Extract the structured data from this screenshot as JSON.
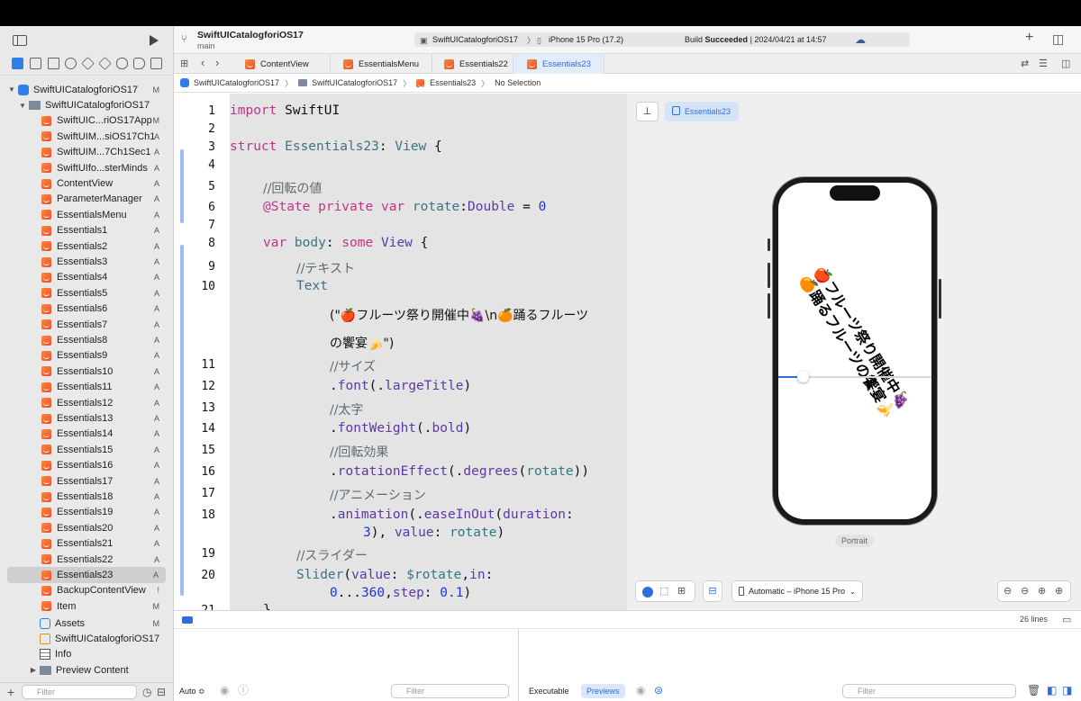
{
  "toolbar": {
    "project_title": "SwiftUICatalogforiOS17",
    "branch": "main",
    "scheme": "SwiftUICatalogforiOS17",
    "device": "iPhone 15 Pro (17.2)",
    "build_prefix": "Build",
    "build_status": "Succeeded",
    "build_time": "| 2024/04/21 at 14:57"
  },
  "tabs": [
    {
      "label": "ContentView"
    },
    {
      "label": "EssentialsMenu"
    },
    {
      "label": "Essentials22"
    },
    {
      "label": "Essentials23"
    }
  ],
  "breadcrumb": [
    "SwiftUICatalogforiOS17",
    "SwiftUICatalogforiOS17",
    "Essentials23",
    "No Selection"
  ],
  "navigator": {
    "root": {
      "label": "SwiftUICatalogforiOS17",
      "status": "M"
    },
    "group": {
      "label": "SwiftUICatalogforiOS17"
    },
    "files": [
      {
        "label": "SwiftUIC...riOS17App",
        "status": "M"
      },
      {
        "label": "SwiftUIM...siOS17Ch1",
        "status": "A"
      },
      {
        "label": "SwiftUIM...7Ch1Sec1",
        "status": "A"
      },
      {
        "label": "SwiftUIfo...sterMinds",
        "status": "A"
      },
      {
        "label": "ContentView",
        "status": "A"
      },
      {
        "label": "ParameterManager",
        "status": "A"
      },
      {
        "label": "EssentialsMenu",
        "status": "A"
      },
      {
        "label": "Essentials1",
        "status": "A"
      },
      {
        "label": "Essentials2",
        "status": "A"
      },
      {
        "label": "Essentials3",
        "status": "A"
      },
      {
        "label": "Essentials4",
        "status": "A"
      },
      {
        "label": "Essentials5",
        "status": "A"
      },
      {
        "label": "Essentials6",
        "status": "A"
      },
      {
        "label": "Essentials7",
        "status": "A"
      },
      {
        "label": "Essentials8",
        "status": "A"
      },
      {
        "label": "Essentials9",
        "status": "A"
      },
      {
        "label": "Essentials10",
        "status": "A"
      },
      {
        "label": "Essentials11",
        "status": "A"
      },
      {
        "label": "Essentials12",
        "status": "A"
      },
      {
        "label": "Essentials13",
        "status": "A"
      },
      {
        "label": "Essentials14",
        "status": "A"
      },
      {
        "label": "Essentials15",
        "status": "A"
      },
      {
        "label": "Essentials16",
        "status": "A"
      },
      {
        "label": "Essentials17",
        "status": "A"
      },
      {
        "label": "Essentials18",
        "status": "A"
      },
      {
        "label": "Essentials19",
        "status": "A"
      },
      {
        "label": "Essentials20",
        "status": "A"
      },
      {
        "label": "Essentials21",
        "status": "A"
      },
      {
        "label": "Essentials22",
        "status": "A"
      },
      {
        "label": "Essentials23",
        "status": "A"
      },
      {
        "label": "BackupContentView",
        "status": "!"
      },
      {
        "label": "Item",
        "status": "M"
      }
    ],
    "assets": {
      "label": "Assets",
      "status": "M"
    },
    "plan": {
      "label": "SwiftUICatalogforiOS17"
    },
    "info": {
      "label": "Info"
    },
    "preview_content": {
      "label": "Preview Content"
    },
    "filter_placeholder": "Filter"
  },
  "editor": {
    "line_numbers": [
      "1",
      "2",
      "3",
      "4",
      "5",
      "6",
      "7",
      "8",
      "9",
      "10",
      "11",
      "12",
      "13",
      "14",
      "15",
      "16",
      "17",
      "18",
      "19",
      "20",
      "21"
    ],
    "code": {
      "l1_kw": "import",
      "l1_rest": " SwiftUI",
      "l3_kw": "struct",
      "l3_type": " Essentials23",
      "l3_colon": ": ",
      "l3_view": "View",
      "l3_brace": " {",
      "l5": "//回転の値",
      "l6_attr": "@State",
      "l6_kw": " private var",
      "l6_name": " rotate",
      "l6_colon": ":",
      "l6_type": "Double",
      "l6_eq": " = ",
      "l6_num": "0",
      "l8_kw": "var",
      "l8_name": " body",
      "l8_colon": ": ",
      "l8_some": "some",
      "l8_view": " View",
      "l8_brace": " {",
      "l9": "//テキスト",
      "l10": "Text",
      "l10b": "(\"🍎フルーツ祭り開催中🍇\\n🍊踊るフルーツ",
      "l10c": "の饗宴🍌\")",
      "l11": "//サイズ",
      "l12_dot": ".",
      "l12_fn": "font",
      "l12_p": "(.",
      "l12_arg": "largeTitle",
      "l12_end": ")",
      "l13": "//太字",
      "l14_dot": ".",
      "l14_fn": "fontWeight",
      "l14_p": "(.",
      "l14_arg": "bold",
      "l14_end": ")",
      "l15": "//回転効果",
      "l16_dot": ".",
      "l16_fn": "rotationEffect",
      "l16_p": "(.",
      "l16_arg": "degrees",
      "l16_p2": "(",
      "l16_var": "rotate",
      "l16_end": "))",
      "l17": "//アニメーション",
      "l18_dot": ".",
      "l18_fn": "animation",
      "l18_p": "(.",
      "l18_arg": "easeInOut",
      "l18_p2": "(",
      "l18_lbl": "duration",
      "l18_c": ":",
      "l18b_num": "3",
      "l18b_mid": "), ",
      "l18b_lbl": "value",
      "l18b_c": ": ",
      "l18b_var": "rotate",
      "l18b_end": ")",
      "l19": "//スライダー",
      "l20_fn": "Slider",
      "l20_p": "(",
      "l20_lbl": "value",
      "l20_c": ": ",
      "l20_var": "$rotate",
      "l20_comma": ",",
      "l20_in": "in",
      "l20_c2": ":",
      "l20b_n1": "0",
      "l20b_dots": "...",
      "l20b_n2": "360",
      "l20b_comma": ",",
      "l20b_step": "step",
      "l20b_c": ": ",
      "l20b_n3": "0.1",
      "l20b_end": ")",
      "l21": "}"
    }
  },
  "preview": {
    "pin_tab": "Essentials23",
    "phone_text_line1": "🍎フルーツ祭り開催中🍇",
    "phone_text_line2": "🍊踊るフルーツの饗宴🍌",
    "slider_value": 0,
    "orientation_label": "Portrait",
    "device_menu": "Automatic – iPhone 15 Pro"
  },
  "debug": {
    "line_count": "26 lines",
    "console_mode": "Auto ≎",
    "filter_placeholder": "Filter",
    "executable_tab": "Executable",
    "previews_tab": "Previews",
    "filter2_placeholder": "Filter"
  },
  "colors": {
    "accent": "#2a6ee0",
    "keyword": "#c2348a",
    "type": "#3a7484",
    "number": "#1d35d8"
  }
}
